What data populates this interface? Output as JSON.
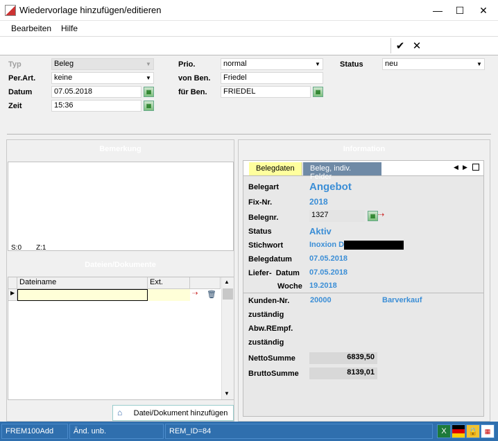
{
  "window": {
    "title": "Wiedervorlage hinzufügen/editieren",
    "minimize": "—",
    "maximize": "☐",
    "close": "✕"
  },
  "menu": {
    "items": [
      "Bearbeiten",
      "Hilfe"
    ]
  },
  "toolbar": {
    "confirm": "✔",
    "cancel": "✕"
  },
  "form": {
    "typ_label": "Typ",
    "typ_value": "Beleg",
    "perart_label": "Per.Art.",
    "perart_value": "keine",
    "datum_label": "Datum",
    "datum_value": "07.05.2018",
    "zeit_label": "Zeit",
    "zeit_value": "15:36",
    "prio_label": "Prio.",
    "prio_value": "normal",
    "vonben_label": "von Ben.",
    "vonben_value": "Friedel",
    "fuerben_label": "für Ben.",
    "fuerben_value": "FRIEDEL",
    "status_label": "Status",
    "status_value": "neu"
  },
  "bemerkung": {
    "title": "Bemerkung",
    "pos_s": "S:0",
    "pos_z": "Z:1"
  },
  "dateien": {
    "title": "Dateien/Dokumente",
    "columns": [
      "Dateiname",
      "Ext."
    ],
    "row_marker": "▶",
    "add_button": "Datei/Dokument hinzufügen"
  },
  "information": {
    "title": "Information",
    "tabs": [
      "Belegdaten",
      "Beleg, indiv. Felder"
    ],
    "belegart_label": "Belegart",
    "belegart_value": "Angebot",
    "fixnr_label": "Fix-Nr.",
    "fixnr_value": "2018",
    "belegnr_label": "Belegnr.",
    "belegnr_value": "1327",
    "status_label": "Status",
    "status_value": "Aktiv",
    "stichwort_label": "Stichwort",
    "stichwort_value": "Inoxion D",
    "belegdatum_label": "Belegdatum",
    "belegdatum_value": "07.05.2018",
    "lieferdatum_label": "Liefer-  Datum",
    "lieferdatum_value": "07.05.2018",
    "woche_label": "Woche",
    "woche_value": "19.2018",
    "kundennr_label": "Kunden-Nr.",
    "kundennr_value": "20000",
    "kunde_name": "Barverkauf",
    "zustaendig1_label": "zuständig",
    "abwrempf_label": "Abw.REmpf.",
    "zustaendig2_label": "zuständig",
    "netto_label": "NettoSumme",
    "netto_value": "6839,50",
    "brutto_label": "BruttoSumme",
    "brutto_value": "8139,01"
  },
  "statusbar": {
    "cell1": "FREM100Add",
    "cell2": "Änd. unb.",
    "cell3": "REM_ID=84"
  },
  "colors": {
    "accent_blue": "#3b8ed6",
    "statusbar": "#2f6fae",
    "active_tab": "#ffff9e",
    "inactive_tab": "#6f8aa6"
  }
}
